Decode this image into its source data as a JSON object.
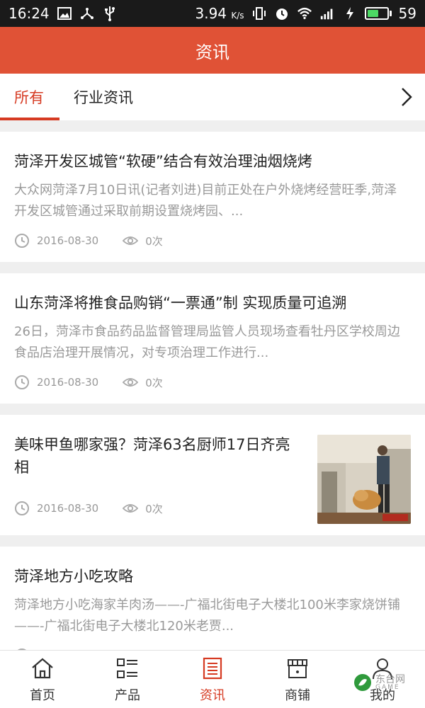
{
  "status_bar": {
    "time": "16:24",
    "speed": "3.94",
    "speed_unit": "K/s",
    "battery": "59",
    "battery_level": 0.59,
    "left_icons": [
      "image-icon",
      "usb-share-icon",
      "usb-icon"
    ],
    "right_icons": [
      "vibrate-icon",
      "alarm-icon",
      "wifi-icon",
      "signal-4g-icon",
      "charging-icon"
    ]
  },
  "header": {
    "title": "资讯"
  },
  "tabs": {
    "items": [
      {
        "label": "所有",
        "active": true
      },
      {
        "label": "行业资讯",
        "active": false
      }
    ],
    "more_icon": "chevron-right-icon"
  },
  "articles": [
    {
      "title": "菏泽开发区城管“软硬”结合有效治理油烟烧烤",
      "summary": "大众网菏泽7月10日讯(记者刘进)目前正处在户外烧烤经营旺季,菏泽开发区城管通过采取前期设置烧烤园、...",
      "date": "2016-08-30",
      "views": "0次"
    },
    {
      "title": "山东菏泽将推食品购销“一票通”制 实现质量可追溯",
      "summary": "26日，菏泽市食品药品监督管理局监管人员现场查看牡丹区学校周边食品店治理开展情况，对专项治理工作进行...",
      "date": "2016-08-30",
      "views": "0次"
    },
    {
      "title": "美味甲鱼哪家强？菏泽63名厨师17日齐亮相",
      "date": "2016-08-30",
      "views": "0次",
      "has_thumbnail": true
    },
    {
      "title": "菏泽地方小吃攻略",
      "summary": "菏泽地方小吃海家羊肉汤——-广福北街电子大楼北100米李家烧饼铺——-广福北街电子大楼北120米老贾...",
      "date": "2016-08-30",
      "views": "0次"
    }
  ],
  "tabbar": {
    "items": [
      {
        "label": "首页",
        "icon": "home-icon",
        "active": false
      },
      {
        "label": "产品",
        "icon": "product-list-icon",
        "active": false
      },
      {
        "label": "资讯",
        "icon": "news-document-icon",
        "active": true
      },
      {
        "label": "商铺",
        "icon": "store-icon",
        "active": false
      },
      {
        "label": "我的",
        "icon": "user-icon",
        "active": false
      }
    ]
  },
  "watermark": {
    "text": "东台网",
    "sub": "GAME"
  },
  "colors": {
    "primary": "#e05236",
    "active": "#d63a22",
    "muted": "#999999",
    "background": "#efefef"
  }
}
